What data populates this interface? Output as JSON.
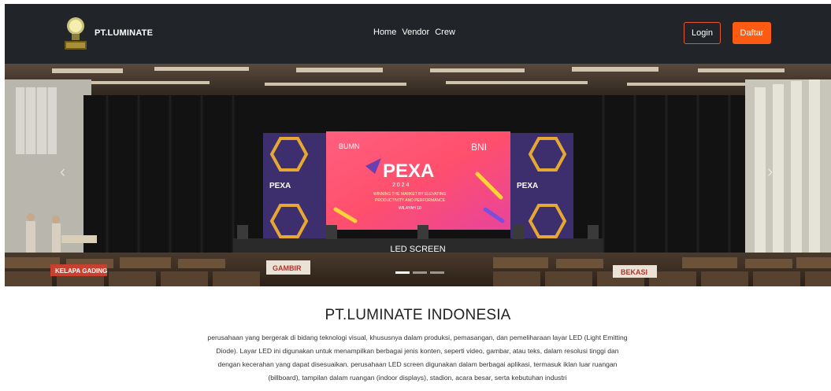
{
  "navbar": {
    "brand": "PT.LUMINATE",
    "logo_icon": "lightbulb-logo-icon",
    "links": [
      "Home",
      "Vendor",
      "Crew"
    ],
    "login_label": "Login",
    "register_label": "Daftar",
    "colors": {
      "background": "#212529",
      "accent": "#fd5a12"
    }
  },
  "hero": {
    "caption": "LED SCREEN",
    "screen_brand": "PEXA",
    "screen_year": "2 0 2 4",
    "screen_tagline_1": "WINNING THE MARKET BY ELEVATING",
    "screen_tagline_2": "PRODUCTIVITY AND PERFORMANCE",
    "screen_sub": "WILAYAH 10",
    "screen_logo_left": "BUMN",
    "screen_logo_right": "BNI",
    "side_label": "PEXA",
    "table_signs": [
      "KELAPA GADING",
      "GAMBIR",
      "BEKASI"
    ],
    "prev_icon": "chevron-left-icon",
    "next_icon": "chevron-right-icon"
  },
  "about": {
    "title": "PT.LUMINATE INDONESIA",
    "description": "perusahaan yang bergerak di bidang teknologi visual, khususnya dalam produksi, pemasangan, dan pemeliharaan layar LED (Light Emitting Diode). Layar LED ini digunakan untuk menampilkan berbagai jenis konten, seperti video, gambar, atau teks, dalam resolusi tinggi dan dengan kecerahan yang dapat disesuaikan. perusahaan LED screen digunakan dalam berbagai aplikasi, termasuk iklan luar ruangan (billboard), tampilan dalam ruangan (indoor displays), stadion, acara besar, serta kebutuhan industri"
  }
}
